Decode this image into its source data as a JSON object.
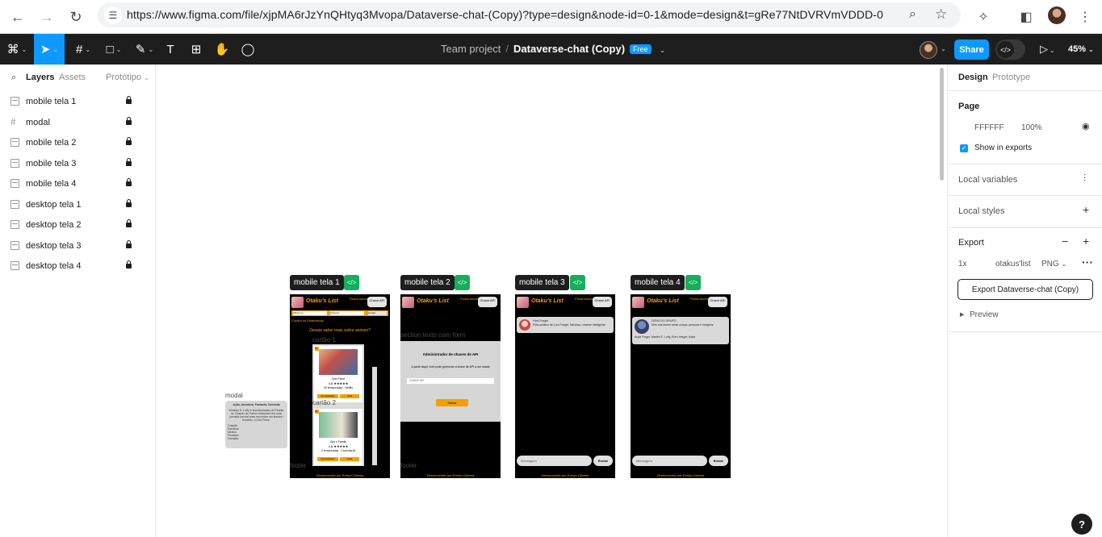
{
  "browser": {
    "url": "https://www.figma.com/file/xjpMA6rJzYnQHtyq3Mvopa/Dataverse-chat-(Copy)?type=design&node-id=0-1&mode=design&t=gRe77NtDVRVmVDDD-0",
    "back_icon": "←",
    "forward_icon": "→",
    "reload_icon": "↻",
    "tune_icon": "☰",
    "zoom_icon": "⌕",
    "star_icon": "☆",
    "extensions_icon": "✧",
    "sidepanel_icon": "◧",
    "menu_icon": "⋮"
  },
  "toolbar": {
    "figma_icon": "⌘",
    "move_icon": "➤",
    "frame_icon": "#",
    "shape_icon": "□",
    "pen_icon": "✎",
    "text_icon": "T",
    "resources_icon": "⊞",
    "hand_icon": "✋",
    "comment_icon": "◯",
    "caret": "⌄",
    "project": "Team project",
    "separator": "/",
    "file_name": "Dataverse-chat (Copy)",
    "plan_badge": "Free",
    "share_label": "Share",
    "dev_mode_icon": "</>",
    "play_icon": "▷",
    "zoom": "45%"
  },
  "left_panel": {
    "search_icon": "⌕",
    "tabs": [
      "Layers",
      "Assets"
    ],
    "page_tab": "Protótipo",
    "layers": [
      {
        "name": "mobile tela 1",
        "type": "frame"
      },
      {
        "name": "modal",
        "type": "hash"
      },
      {
        "name": "mobile tela 2",
        "type": "frame"
      },
      {
        "name": "mobile tela 3",
        "type": "frame"
      },
      {
        "name": "mobile tela 4",
        "type": "frame"
      },
      {
        "name": "desktop tela 1",
        "type": "frame"
      },
      {
        "name": "desktop tela 2",
        "type": "frame"
      },
      {
        "name": "desktop tela 3",
        "type": "frame"
      },
      {
        "name": "desktop tela 4",
        "type": "frame"
      }
    ]
  },
  "canvas": {
    "frames": [
      {
        "label": "mobile tela 1"
      },
      {
        "label": "mobile tela 2"
      },
      {
        "label": "mobile tela 3"
      },
      {
        "label": "mobile tela 4"
      }
    ],
    "code_icon": "</>",
    "phone": {
      "brand": "Otaku's List",
      "portal": "Portal Anime",
      "key_btn": "Chave API",
      "footer": "Desenvolvido por Evelyn Oliveira"
    },
    "screen1": {
      "filter_label": "Filtrar por",
      "order_label": "Ordenar",
      "clear_label": "Limpar",
      "stats_label": "Confira as Estatísticas",
      "question": "Deseja saber mais sobre animes?",
      "ghost_card": "cartão 1",
      "ghost_card2": "cartão 2",
      "ghost_footer": "footer",
      "cards": [
        {
          "tag": "11",
          "title": "One Piece",
          "rating": "4.8 ★★★★★",
          "seasons": "20 temporadas - Netflix",
          "btn1": "Curiosidades",
          "btn2": "Chat"
        },
        {
          "tag": "34",
          "title": "Spy x Family",
          "rating": "4.8 ★★★★★",
          "seasons": "2 temporadas - Crunchyroll",
          "btn1": "Curiosidades",
          "btn2": "Chat"
        }
      ]
    },
    "modal": {
      "ghost": "modal",
      "genres": "Ação, Aventura, Fantasia, Comédia",
      "text": "Monkey D. Luffy e sua tripulação de Piratas do Chapéu de Palha embarcam em uma jornada incrível para encontrar um tesouro lendário, o One Piece.",
      "fields": "Criação:\nEstúdios:\nDiretor:\nProdutor:\nDuração:"
    },
    "screen2": {
      "ghost_section": "section texto com form",
      "title": "Administrador de chaves de API",
      "subtitle": "A partir daqui você pode gerenciar a chave de API a ser usada",
      "input_placeholder": "CHAVE API",
      "save": "Salvar",
      "ghost_footer": "footer"
    },
    "screen3": {
      "chat_name": "Vinsi Foxgin",
      "chat_text": "Filho adotivo de Lord Foxgin, fabuloso, charme inteligente",
      "input": "Mensagem",
      "send": "Enviar"
    },
    "screen4": {
      "chat_name": "DONO DO GRUPO",
      "chat_text": "Eles nos fazem sentir coisas, pessoas e imagens",
      "chat_text2": "Anya Forger, Marlen E. Luffy, Eren Yeager, Astar",
      "input": "Mensagem",
      "send": "Enviar"
    }
  },
  "right_panel": {
    "tabs": [
      "Design",
      "Prototype"
    ],
    "page_title": "Page",
    "page_color": "FFFFFF",
    "page_opacity": "100%",
    "eye_icon": "◉",
    "show_exports": "Show in exports",
    "local_variables": "Local variables",
    "local_styles": "Local styles",
    "export_title": "Export",
    "scale": "1x",
    "suffix": "otakus'list",
    "format": "PNG",
    "export_button": "Export Dataverse-chat (Copy)",
    "preview": "Preview",
    "help": "?"
  },
  "colors": {
    "figma_blue": "#0d99ff",
    "dev_green": "#14ae5c",
    "anime_orange": "#f5a000",
    "toolbar_dark": "#1e1e1e"
  }
}
